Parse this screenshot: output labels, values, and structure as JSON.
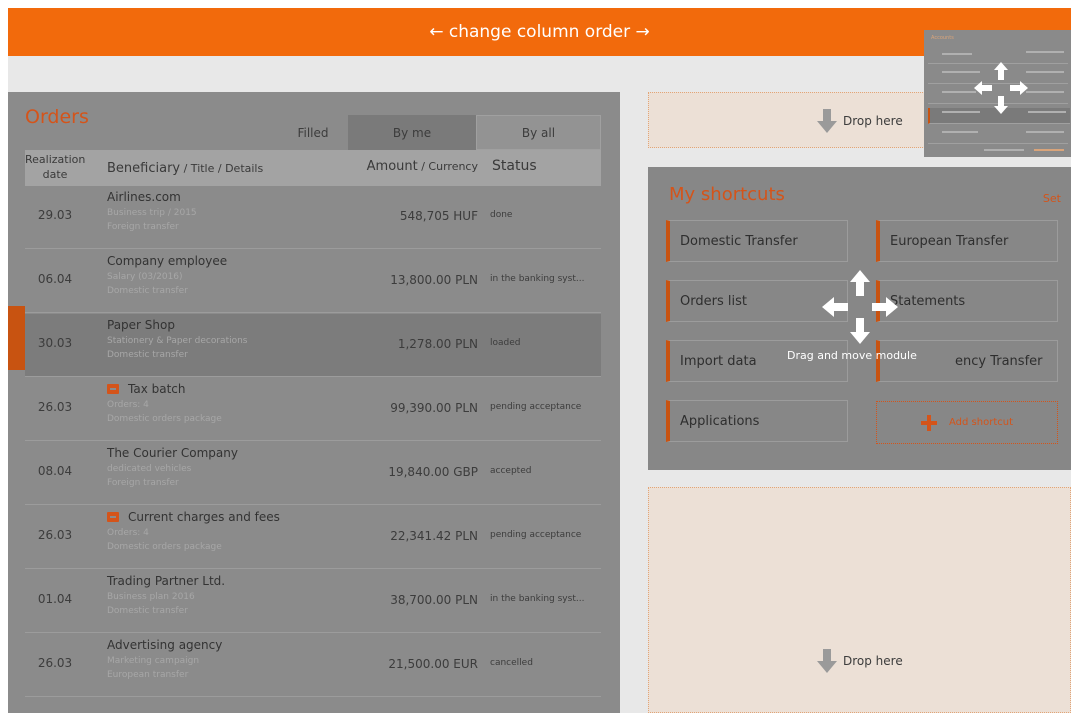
{
  "topbar": {
    "label": "← change column order →"
  },
  "orders": {
    "title": "Orders",
    "tabs": [
      "Filled",
      "By me",
      "By all"
    ],
    "columns": {
      "date": "Realization date",
      "beneficiary": "Beneficiary",
      "beneficiary_extra": " / Title / Details",
      "amount": "Amount",
      "amount_extra": " / Currency",
      "status": "Status"
    },
    "rows": [
      {
        "date": "29.03",
        "title": "Airlines.com",
        "line1": "Business trip / 2015",
        "line2": "Foreign transfer",
        "amount": "548,705 HUF",
        "status": "done",
        "icon": ""
      },
      {
        "date": "06.04",
        "title": "Company employee",
        "line1": "Salary (03/2016)",
        "line2": "Domestic transfer",
        "amount": "13,800.00 PLN",
        "status": "in the banking syst...",
        "icon": ""
      },
      {
        "date": "30.03",
        "title": "Paper Shop",
        "line1": "Stationery & Paper decorations",
        "line2": "Domestic transfer",
        "amount": "1,278.00 PLN",
        "status": "loaded",
        "icon": ""
      },
      {
        "date": "26.03",
        "title": "Tax batch",
        "line1": "Orders: 4",
        "line2": "Domestic orders package",
        "amount": "99,390.00 PLN",
        "status": "pending acceptance",
        "icon": "batch-icon"
      },
      {
        "date": "08.04",
        "title": "The Courier Company",
        "line1": "dedicated vehicles",
        "line2": "Foreign transfer",
        "amount": "19,840.00 GBP",
        "status": "accepted",
        "icon": ""
      },
      {
        "date": "26.03",
        "title": "Current charges and fees",
        "line1": "Orders: 4",
        "line2": "Domestic orders package",
        "amount": "22,341.42 PLN",
        "status": "pending acceptance",
        "icon": "batch-icon"
      },
      {
        "date": "01.04",
        "title": "Trading Partner Ltd.",
        "line1": "Business plan 2016",
        "line2": "Domestic transfer",
        "amount": "38,700.00 PLN",
        "status": "in the banking syst...",
        "icon": ""
      },
      {
        "date": "26.03",
        "title": "Advertising agency",
        "line1": "Marketing campaign",
        "line2": "European transfer",
        "amount": "21,500.00 EUR",
        "status": "cancelled",
        "icon": ""
      }
    ]
  },
  "dropzones": {
    "top_label": "Drop here",
    "bottom_label": "Drop here"
  },
  "shortcuts": {
    "title": "My shortcuts",
    "set_label": "Set",
    "buttons": [
      "Domestic Transfer",
      "European Transfer",
      "Orders list",
      "Statements",
      "Import data",
      "Currency Transfer",
      "Applications"
    ],
    "visible_partial": "ency Transfer",
    "add_label": "Add shortcut",
    "drag_label": "Drag and move module"
  },
  "mini_preview": {
    "title": "Accounts"
  },
  "colors": {
    "accent": "#f26a0c",
    "marker": "#c85311",
    "panel": "#8b8b8b",
    "drop": "#ece0d6"
  }
}
